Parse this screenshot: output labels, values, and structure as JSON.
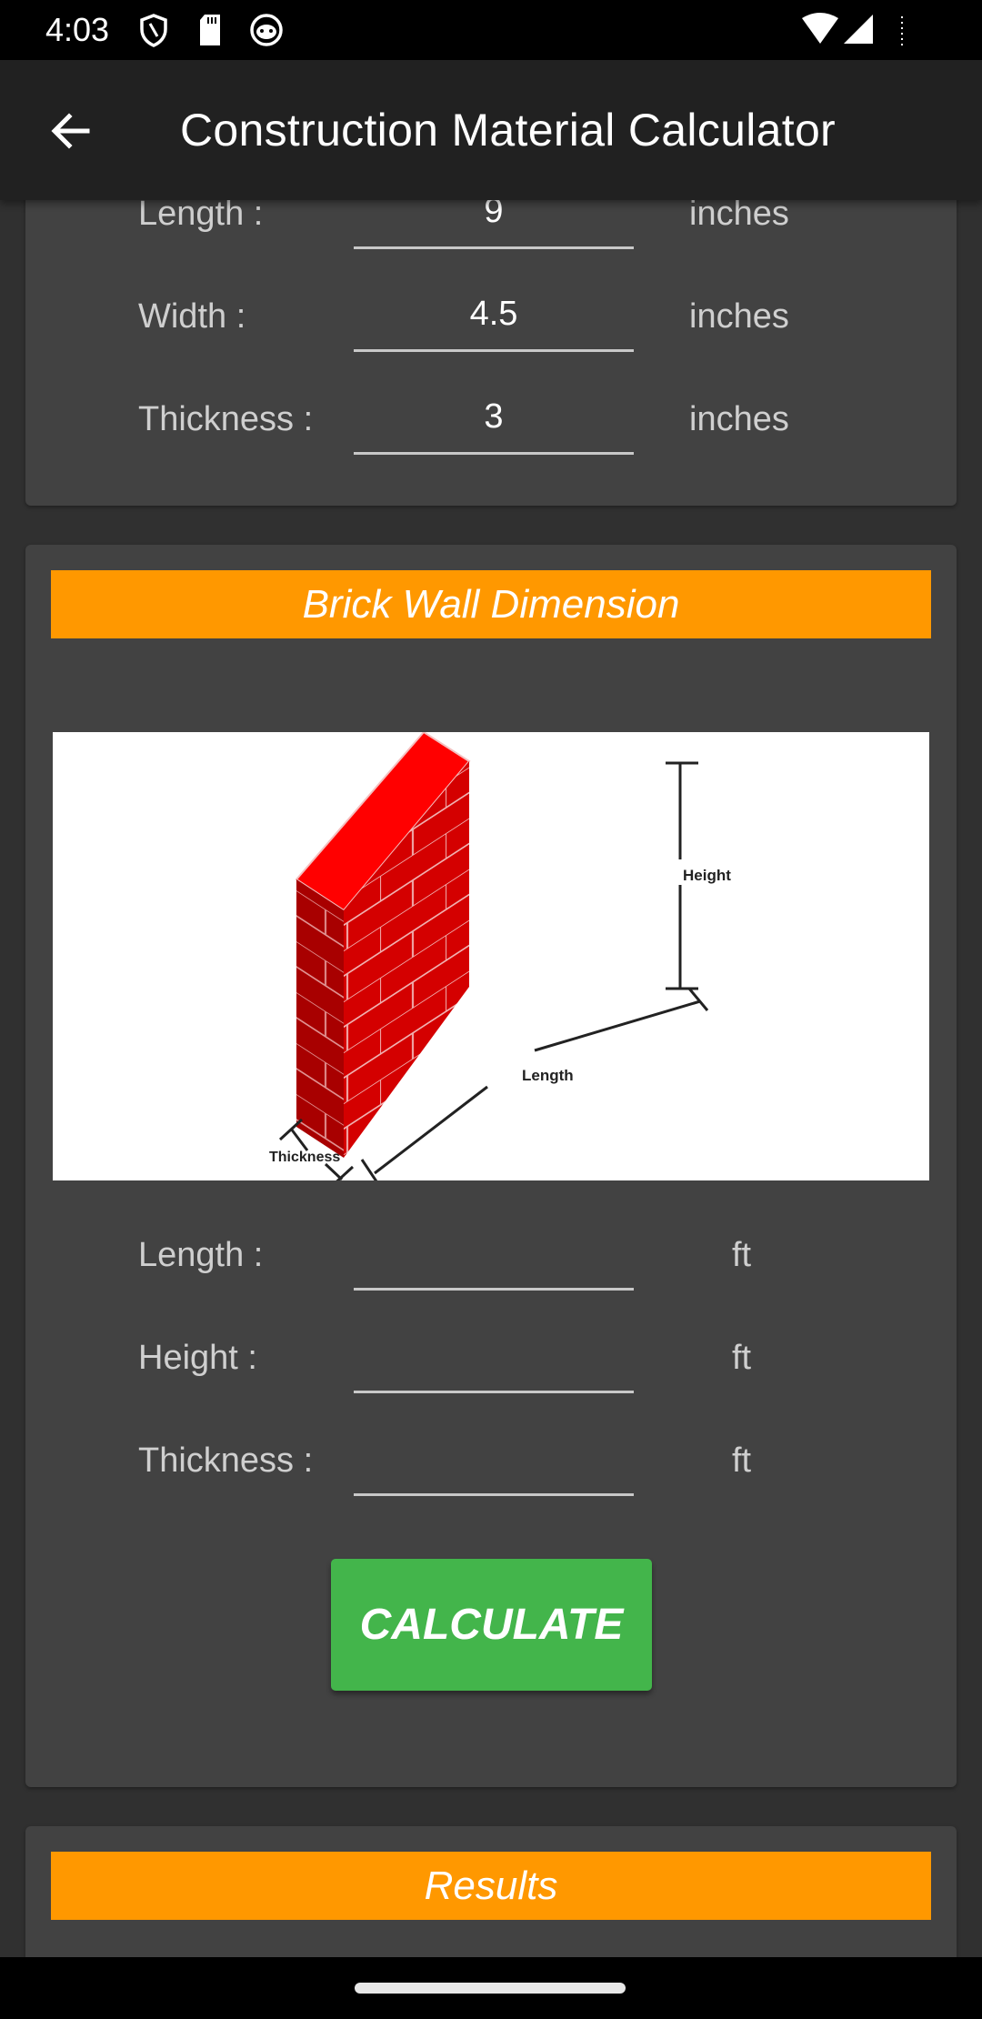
{
  "status_bar": {
    "time": "4:03",
    "left_icons": [
      "shield-icon",
      "sd-card-icon",
      "cat-face-icon"
    ],
    "right_icons": [
      "wifi-icon",
      "signal-icon",
      "battery-icon"
    ]
  },
  "app_bar": {
    "back_icon": "arrow-left-icon",
    "title": "Construction Material Calculator"
  },
  "brick_size_card": {
    "rows": [
      {
        "label": "Length :",
        "value": "9",
        "unit": "inches"
      },
      {
        "label": "Width :",
        "value": "4.5",
        "unit": "inches"
      },
      {
        "label": "Thickness :",
        "value": "3",
        "unit": "inches"
      }
    ]
  },
  "wall_card": {
    "header": "Brick Wall Dimension",
    "image_labels": {
      "height": "Height",
      "length": "Length",
      "thickness": "Thickness"
    },
    "rows": [
      {
        "label": "Length :",
        "value": "",
        "unit": "ft"
      },
      {
        "label": "Height :",
        "value": "",
        "unit": "ft"
      },
      {
        "label": "Thickness :",
        "value": "",
        "unit": "ft"
      }
    ],
    "calculate_label": "CALCULATE"
  },
  "results_card": {
    "header": "Results"
  },
  "colors": {
    "accent_orange": "#ff9800",
    "button_green": "#43b54b",
    "card_bg": "#424242",
    "brick_red": "#e00000"
  }
}
